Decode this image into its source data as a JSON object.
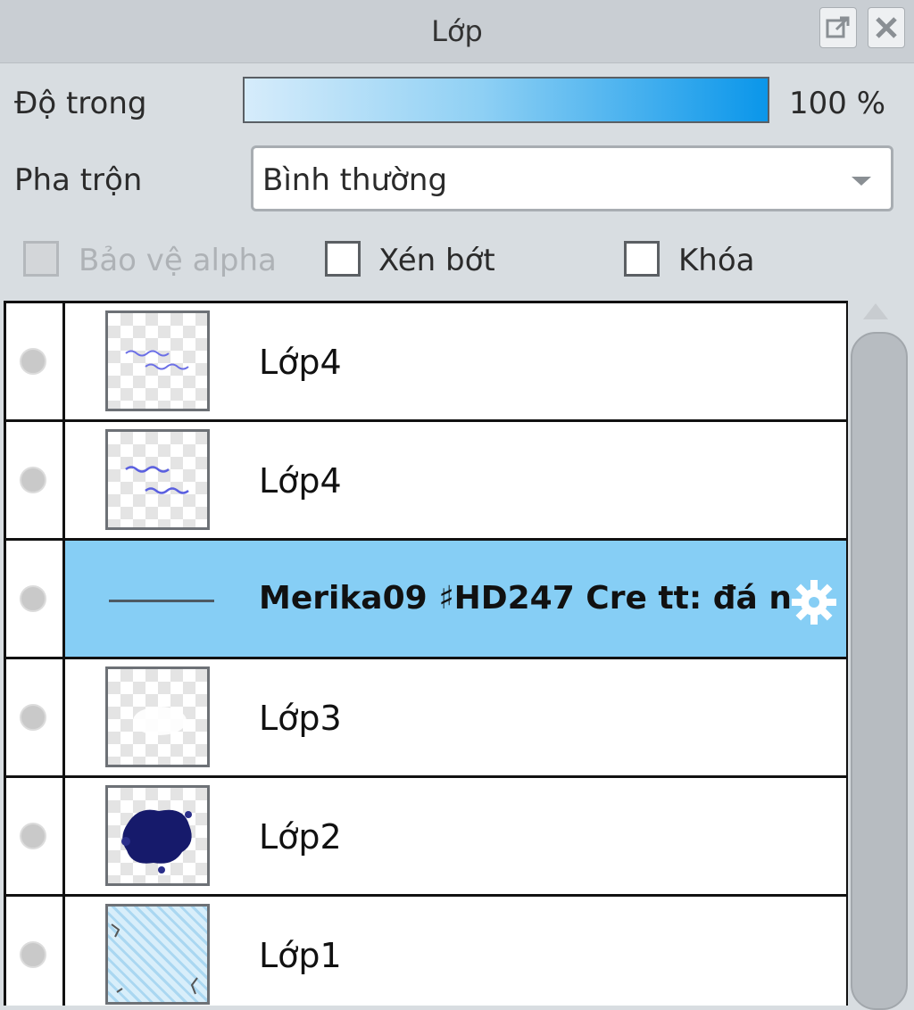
{
  "panel": {
    "title": "Lớp"
  },
  "opacity": {
    "label": "Độ trong",
    "value_text": "100 %",
    "level": 1.0
  },
  "blend": {
    "label": "Pha trộn",
    "selected": "Bình thường"
  },
  "checkboxes": [
    {
      "label": "Bảo vệ alpha",
      "checked": false,
      "disabled": true
    },
    {
      "label": "Xén bớt",
      "checked": false,
      "disabled": false
    },
    {
      "label": "Khóa",
      "checked": false,
      "disabled": false
    }
  ],
  "layers": [
    {
      "name": "Lớp4",
      "selected": false,
      "thumb": "scribble"
    },
    {
      "name": "Lớp4",
      "selected": false,
      "thumb": "scribble"
    },
    {
      "name": "Merika09 ♯HD247 Cre tt: đá n",
      "selected": true,
      "thumb": "line"
    },
    {
      "name": "Lớp3",
      "selected": false,
      "thumb": "white-smudge"
    },
    {
      "name": "Lớp2",
      "selected": false,
      "thumb": "navy-blot"
    },
    {
      "name": "Lớp1",
      "selected": false,
      "thumb": "blue-hatch"
    }
  ],
  "colors": {
    "selection": "#86cef5",
    "accent": "#0a96ea"
  },
  "icons": [
    "popout-icon",
    "close-icon",
    "dropdown-arrow-icon",
    "visibility-dot-icon",
    "gear-icon"
  ]
}
